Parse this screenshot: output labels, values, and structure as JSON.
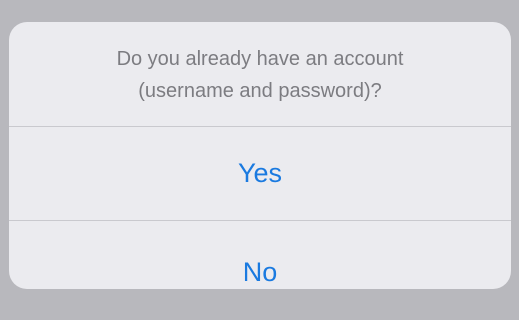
{
  "alert": {
    "message_line1": "Do you already have an account",
    "message_line2": "(username and password)?",
    "yes_label": "Yes",
    "no_label": "No"
  },
  "colors": {
    "sheet_background": "#ebebef",
    "message_text": "#7c7c81",
    "action_text": "#1a7ae0",
    "divider": "#c9c9ce"
  }
}
